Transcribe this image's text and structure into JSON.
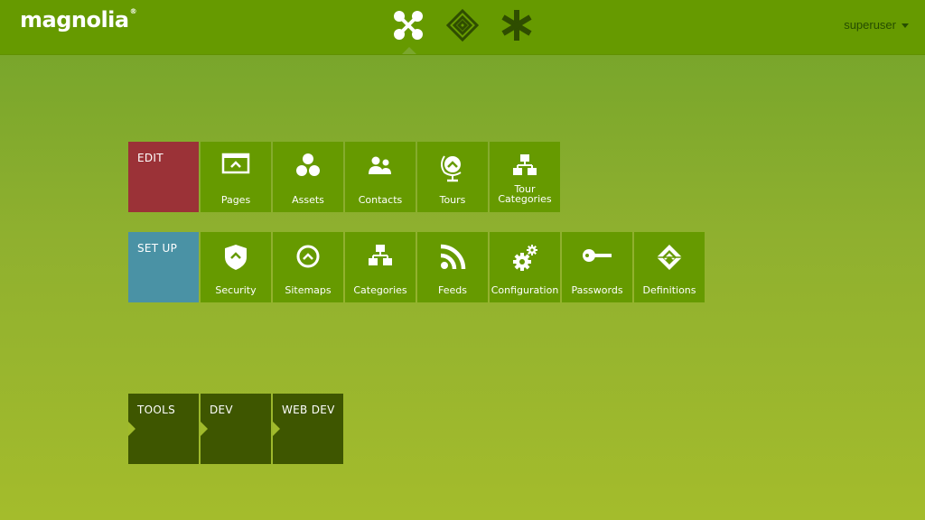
{
  "header": {
    "logo_text": "magnolia",
    "logo_mark": "®",
    "nav": [
      {
        "icon": "apps-icon",
        "active": true
      },
      {
        "icon": "pulse-icon"
      },
      {
        "icon": "favorites-icon"
      }
    ],
    "user": "superuser"
  },
  "groups": {
    "edit": {
      "label": "EDIT",
      "color": "#9b3237",
      "apps": [
        {
          "label": "Pages",
          "icon": "pages-icon"
        },
        {
          "label": "Assets",
          "icon": "assets-icon"
        },
        {
          "label": "Contacts",
          "icon": "contacts-icon"
        },
        {
          "label": "Tours",
          "icon": "tours-icon"
        },
        {
          "label": "Tour\nCategories",
          "label_line1": "Tour",
          "label_line2": "Categories",
          "icon": "tour-categories-icon"
        }
      ]
    },
    "setup": {
      "label": "SET UP",
      "color": "#4a92a5",
      "apps": [
        {
          "label": "Security",
          "icon": "security-icon"
        },
        {
          "label": "Sitemaps",
          "icon": "sitemaps-icon"
        },
        {
          "label": "Categories",
          "icon": "categories-icon"
        },
        {
          "label": "Feeds",
          "icon": "feeds-icon"
        },
        {
          "label": "Configuration",
          "icon": "configuration-icon"
        },
        {
          "label": "Passwords",
          "icon": "passwords-icon"
        },
        {
          "label": "Definitions",
          "icon": "definitions-icon"
        }
      ]
    },
    "collapsed": [
      {
        "label": "TOOLS"
      },
      {
        "label": "DEV"
      },
      {
        "label": "WEB DEV"
      }
    ]
  },
  "colors": {
    "header": "#669a00",
    "tile": "#669a00",
    "collapsed_tile": "#3e5600"
  }
}
